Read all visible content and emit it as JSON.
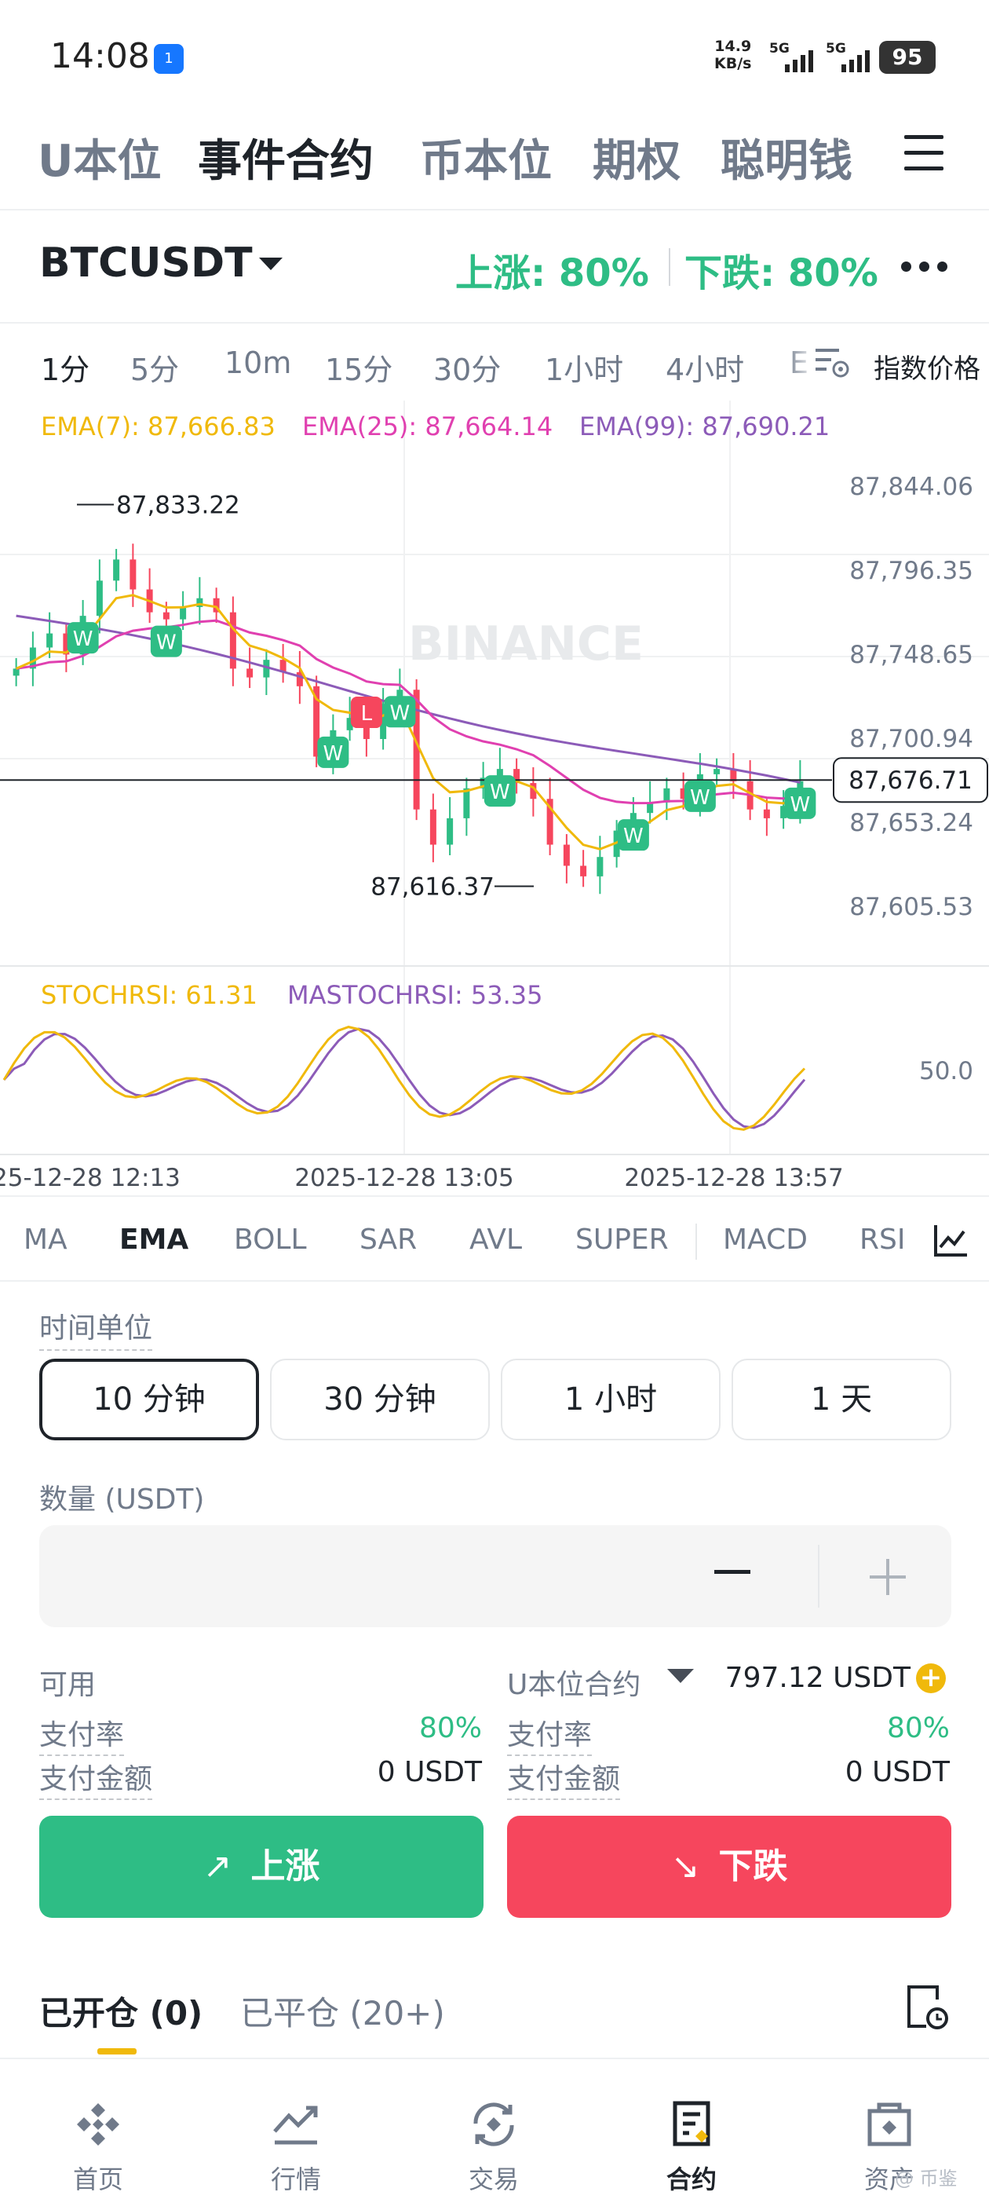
{
  "status_bar": {
    "time": "14:08",
    "hotspot_badge": "1",
    "net_speed_value": "14.9",
    "net_speed_unit": "KB/s",
    "sim1": "5G",
    "sim2": "5G",
    "battery": "95"
  },
  "top_tabs": [
    {
      "label": "U本位"
    },
    {
      "label": "事件合约",
      "active": true
    },
    {
      "label": "币本位"
    },
    {
      "label": "期权"
    },
    {
      "label": "聪明钱"
    }
  ],
  "symbol": {
    "name": "BTCUSDT",
    "up_rate": "上涨: 80%",
    "down_rate": "下跌: 80%"
  },
  "intervals": [
    {
      "label": "1分",
      "active": true
    },
    {
      "label": "5分"
    },
    {
      "label": "10m"
    },
    {
      "label": "15分"
    },
    {
      "label": "30分"
    },
    {
      "label": "1小时"
    },
    {
      "label": "4小时"
    },
    {
      "label": "E"
    }
  ],
  "index_price_label": "指数价格",
  "chart": {
    "ema7": "EMA(7): 87,666.83",
    "ema25": "EMA(25): 87,664.14",
    "ema99": "EMA(99): 87,690.21",
    "price_ticks": [
      "87,844.06",
      "87,796.35",
      "87,748.65",
      "87,700.94",
      "87,653.24",
      "87,605.53"
    ],
    "current_price": "87,676.71",
    "high_label": "87,833.22",
    "low_label": "87,616.37",
    "watermark": "BINANCE",
    "stoch_label": "STOCHRSI: 61.31",
    "mastoch_label": "MASTOCHRSI: 53.35",
    "stoch_tick": "50.0",
    "time_labels": [
      "25-12-28 12:13",
      "2025-12-28 13:05",
      "2025-12-28 13:57"
    ],
    "colors": {
      "up": "#2ebd85",
      "down": "#f6465d",
      "ema7": "#f0b90b",
      "ema25": "#e040b0",
      "ema99": "#8c5bb8"
    }
  },
  "chart_data": {
    "type": "candlestick",
    "title": "",
    "xlabel": "",
    "ylabel": "",
    "x_ticks": [
      "25-12-28 12:13",
      "2025-12-28 13:05",
      "2025-12-28 13:57"
    ],
    "y_ticks": [
      87605.53,
      87653.24,
      87700.94,
      87748.65,
      87796.35,
      87844.06
    ],
    "ylim": [
      87580,
      87870
    ],
    "high": 87833.22,
    "low": 87616.37,
    "current": 87676.71,
    "close_estimates": [
      87740,
      87752,
      87760,
      87748,
      87770,
      87790,
      87802,
      87785,
      87772,
      87768,
      87775,
      87780,
      87772,
      87740,
      87735,
      87745,
      87738,
      87730,
      87690,
      87705,
      87712,
      87700,
      87720,
      87728,
      87660,
      87640,
      87655,
      87672,
      87678,
      87683,
      87675,
      87666,
      87640,
      87628,
      87622,
      87633,
      87648,
      87658,
      87664,
      87672,
      87666,
      87680,
      87683,
      87676,
      87660,
      87655,
      87662,
      87676
    ],
    "series": [
      {
        "name": "EMA(7)",
        "last": 87666.83
      },
      {
        "name": "EMA(25)",
        "last": 87664.14
      },
      {
        "name": "EMA(99)",
        "last": 87690.21
      }
    ],
    "stoch_rsi": 61.31,
    "ma_stoch_rsi": 53.35
  },
  "indicator_tabs": [
    {
      "label": "MA"
    },
    {
      "label": "EMA",
      "active": true
    },
    {
      "label": "BOLL"
    },
    {
      "label": "SAR"
    },
    {
      "label": "AVL"
    },
    {
      "label": "SUPER"
    },
    {
      "label": "MACD"
    },
    {
      "label": "RSI"
    }
  ],
  "time_unit": {
    "label": "时间单位",
    "options": [
      {
        "label": "10 分钟",
        "active": true
      },
      {
        "label": "30 分钟"
      },
      {
        "label": "1 小时"
      },
      {
        "label": "1 天"
      }
    ]
  },
  "quantity": {
    "label": "数量 (USDT)",
    "value": ""
  },
  "account": {
    "available_label": "可用",
    "account_type": "U本位合约",
    "balance": "797.12 USDT",
    "payout_rate_label": "支付率",
    "payout_rate_up": "80%",
    "payout_rate_down": "80%",
    "payout_amount_label": "支付金额",
    "payout_amount_up": "0 USDT",
    "payout_amount_down": "0 USDT"
  },
  "actions": {
    "up": "上涨",
    "down": "下跌"
  },
  "positions": {
    "open": "已开仓 (0)",
    "closed": "已平仓 (20+)"
  },
  "bottom_nav": [
    {
      "label": "首页",
      "icon": "home-icon"
    },
    {
      "label": "行情",
      "icon": "markets-icon"
    },
    {
      "label": "交易",
      "icon": "trade-icon"
    },
    {
      "label": "合约",
      "icon": "futures-icon",
      "active": true
    },
    {
      "label": "资产",
      "icon": "wallet-icon"
    }
  ],
  "watermark": "@ 币鉴"
}
